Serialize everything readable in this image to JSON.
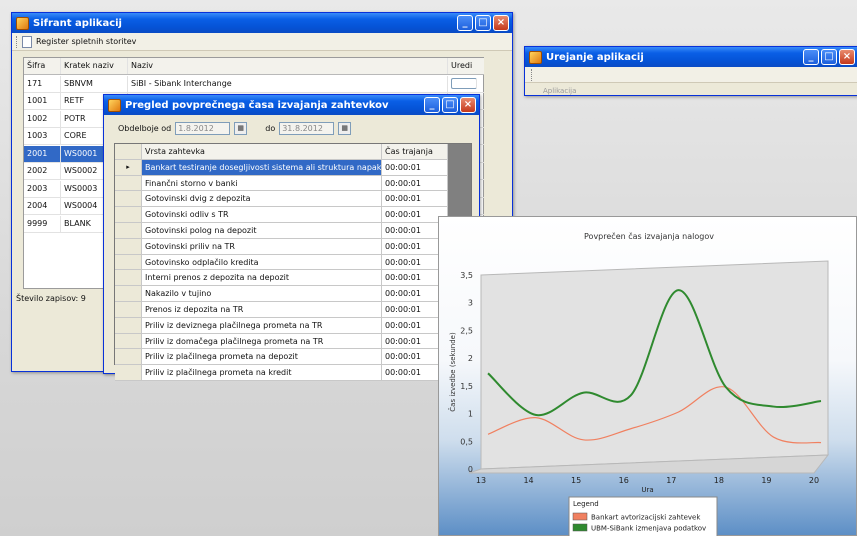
{
  "sifrant": {
    "title": "Šifrant aplikacij",
    "menu_label": "Register spletnih storitev",
    "columns": [
      "Šifra",
      "Kratek naziv",
      "Naziv",
      "Uredi"
    ],
    "rows": [
      {
        "sifra": "171",
        "kratek": "SBNVM",
        "naziv": "SiBI - Sibank Interchange"
      },
      {
        "sifra": "1001",
        "kratek": "RETF",
        "naziv": ""
      },
      {
        "sifra": "1002",
        "kratek": "POTR",
        "naziv": ""
      },
      {
        "sifra": "1003",
        "kratek": "CORE",
        "naziv": ""
      },
      {
        "sifra": "2001",
        "kratek": "WS0001",
        "naziv": ""
      },
      {
        "sifra": "2002",
        "kratek": "WS0002",
        "naziv": ""
      },
      {
        "sifra": "2003",
        "kratek": "WS0003",
        "naziv": ""
      },
      {
        "sifra": "2004",
        "kratek": "WS0004",
        "naziv": ""
      },
      {
        "sifra": "9999",
        "kratek": "BLANK",
        "naziv": ""
      }
    ],
    "selected_row": 4,
    "status": "Število zapisov: 9"
  },
  "urejanje": {
    "title": "Urejanje aplikacij",
    "faint_label": "Aplikacija"
  },
  "pregled": {
    "title": "Pregled povprečnega časa izvajanja zahtevkov",
    "from_label": "Obdelboje od",
    "from_value": "1.8.2012",
    "to_label": "do",
    "to_value": "31.8.2012",
    "columns": [
      "Vrsta zahtevka",
      "Čas trajanja"
    ],
    "rows": [
      {
        "vrsta": "Bankart testiranje dosegljivosti sistema ali struktura napaka",
        "cas": "00:00:01"
      },
      {
        "vrsta": "Finančni storno v banki",
        "cas": "00:00:01"
      },
      {
        "vrsta": "Gotovinski dvig z depozita",
        "cas": "00:00:01"
      },
      {
        "vrsta": "Gotovinski odliv s TR",
        "cas": "00:00:01"
      },
      {
        "vrsta": "Gotovinski polog na depozit",
        "cas": "00:00:01"
      },
      {
        "vrsta": "Gotovinski priliv na TR",
        "cas": "00:00:01"
      },
      {
        "vrsta": "Gotovinsko odplačilo kredita",
        "cas": "00:00:01"
      },
      {
        "vrsta": "Interni prenos z depozita na depozit",
        "cas": "00:00:01"
      },
      {
        "vrsta": "Nakazilo v tujino",
        "cas": "00:00:01"
      },
      {
        "vrsta": "Prenos iz depozita na TR",
        "cas": "00:00:01"
      },
      {
        "vrsta": "Priliv iz deviznega plačilnega prometa na TR",
        "cas": "00:00:01"
      },
      {
        "vrsta": "Priliv iz domačega plačilnega prometa na TR",
        "cas": "00:00:01"
      },
      {
        "vrsta": "Priliv iz plačilnega prometa na depozit",
        "cas": "00:00:01"
      },
      {
        "vrsta": "Priliv iz plačilnega prometa na kredit",
        "cas": "00:00:01"
      }
    ],
    "selected_row": 0,
    "current_row_marker": "▸"
  },
  "window_buttons": {
    "minimize": "_",
    "maximize": "□",
    "close": "×"
  },
  "calendar_glyph": "▦",
  "colors": {
    "titlebar": "#0553d6",
    "selection": "#3169c6",
    "series_red": "#f08060",
    "series_green": "#2f8a2f"
  },
  "chart_data": {
    "type": "line",
    "title": "Povprečen čas izvajanja nalogov",
    "xlabel": "Ura",
    "ylabel": "Čas izvedbe (sekunde)",
    "x_ticks": [
      "13",
      "14",
      "15",
      "16",
      "17",
      "18",
      "19",
      "20"
    ],
    "y_ticks": [
      "0",
      "0,5",
      "1",
      "1,5",
      "2",
      "2,5",
      "3",
      "3,5"
    ],
    "xlim": [
      13,
      20
    ],
    "ylim": [
      0,
      3.5
    ],
    "grid": false,
    "legend": {
      "title": "Legend",
      "placement": "bottom"
    },
    "series": [
      {
        "name": "Bankart avtorizacijski zahtevek",
        "color": "#f08060",
        "x": [
          13,
          14,
          15,
          16,
          17,
          18,
          19,
          20
        ],
        "y": [
          0.5,
          0.8,
          0.4,
          0.6,
          0.9,
          1.35,
          0.45,
          0.35
        ]
      },
      {
        "name": "UBM-SiBank izmenjava podatkov",
        "color": "#2f8a2f",
        "x": [
          13,
          14,
          15,
          16,
          17,
          18,
          19,
          20
        ],
        "y": [
          1.6,
          0.85,
          1.25,
          1.2,
          3.1,
          1.35,
          1.0,
          1.1
        ]
      }
    ]
  }
}
